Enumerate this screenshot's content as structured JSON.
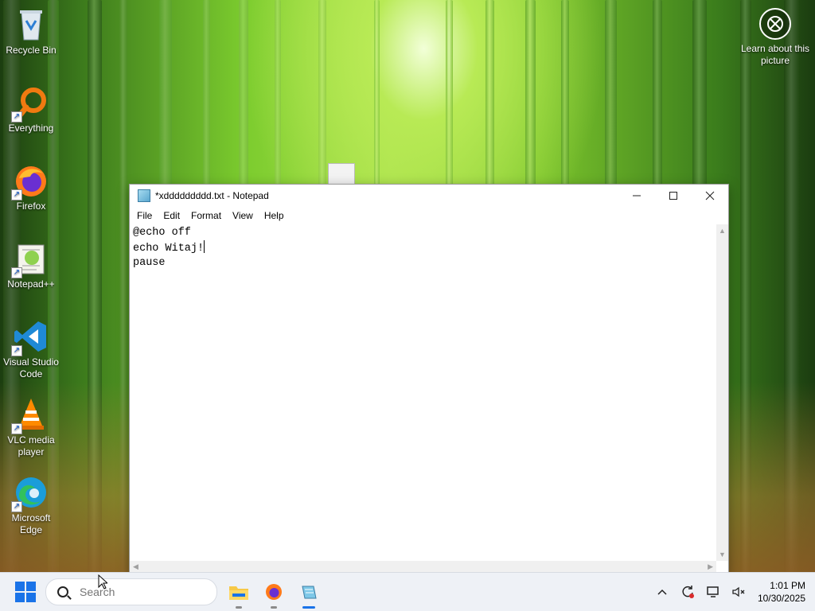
{
  "desktop": {
    "icons": [
      {
        "label": "Recycle Bin",
        "icon": "recycle-bin-icon"
      },
      {
        "label": "Everything",
        "icon": "everything-search-icon"
      },
      {
        "label": "Firefox",
        "icon": "firefox-icon"
      },
      {
        "label": "Notepad++",
        "icon": "notepadpp-icon"
      },
      {
        "label": "Visual Studio Code",
        "icon": "vscode-icon"
      },
      {
        "label": "VLC media player",
        "icon": "vlc-icon"
      },
      {
        "label": "Microsoft Edge",
        "icon": "edge-icon"
      }
    ],
    "learn_label": "Learn about this picture"
  },
  "window": {
    "title": "*xddddddddd.txt - Notepad",
    "menu": [
      "File",
      "Edit",
      "Format",
      "View",
      "Help"
    ],
    "content_lines": [
      "@echo off",
      "echo Witaj!",
      "pause"
    ],
    "colors": {
      "accent": "#1a73e8"
    }
  },
  "taskbar": {
    "search_placeholder": "Search",
    "pinned": [
      "file-explorer-icon",
      "firefox-icon",
      "notepad-icon"
    ],
    "time": "1:01 PM",
    "date": "10/30/2025"
  }
}
